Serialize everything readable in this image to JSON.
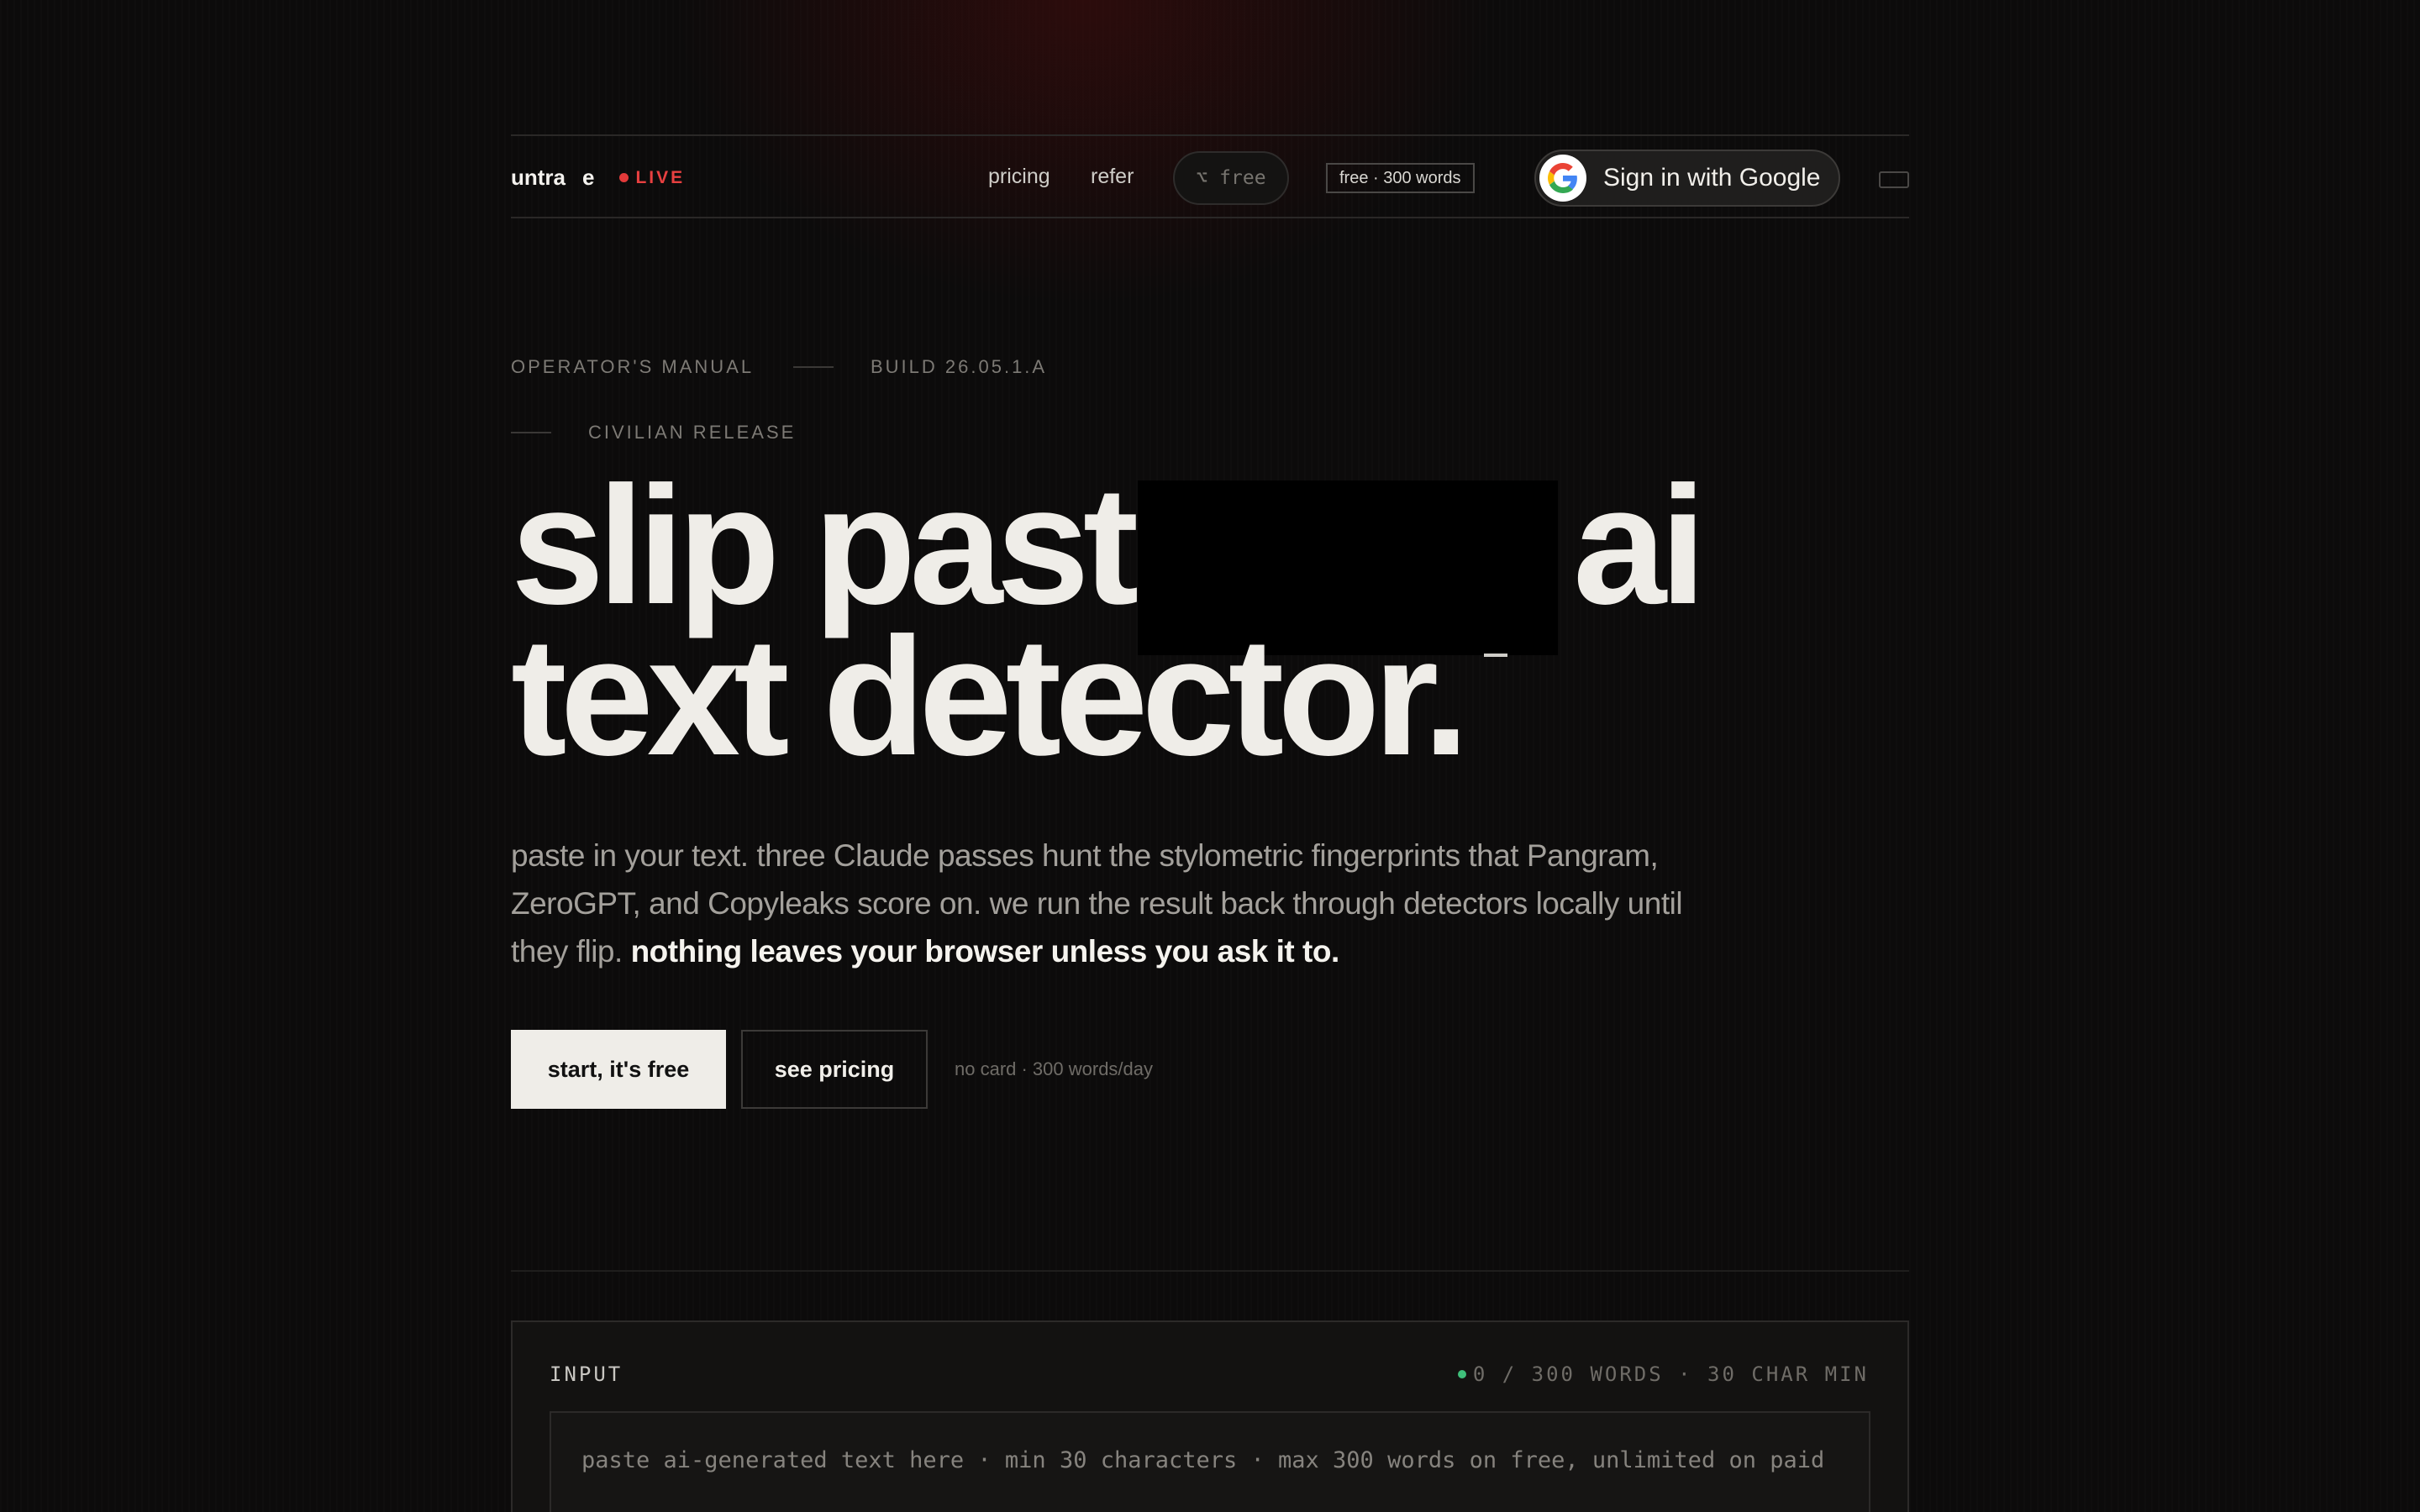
{
  "nav": {
    "brand_name": "untra",
    "brand_mark": "e",
    "live_label": "LIVE",
    "links": {
      "pricing": "pricing",
      "refer": "refer"
    },
    "free_pill": "⌥ free",
    "free_badge": "free · 300 words",
    "google_sign_in": "Sign in with Google"
  },
  "eyebrow": {
    "manual": "OPERATOR'S MANUAL",
    "build": "BUILD 26.05.1.A",
    "release": "CIVILIAN RELEASE"
  },
  "headline": {
    "line1_start": "slip past",
    "line1_end": "ai",
    "line2": "text detector."
  },
  "subheadline": {
    "body": "paste in your text. three Claude passes hunt the stylometric fingerprints that Pangram, ZeroGPT, and Copyleaks score on. we run the result back through detectors locally until they flip. ",
    "emphasis": "nothing leaves your browser unless you ask it to."
  },
  "cta": {
    "primary": "start, it's free",
    "secondary": "see pricing",
    "note": "no card · 300 words/day"
  },
  "input_panel": {
    "label": "INPUT",
    "counter": "0 / 300 WORDS · 30 CHAR MIN",
    "placeholder": "paste ai-generated text here · min 30 characters · max 300 words on free, unlimited on paid"
  },
  "colors": {
    "background": "#0c0b0b",
    "live_red": "#e84040",
    "status_green": "#3fbf7a",
    "primary_button": "#efede8"
  }
}
